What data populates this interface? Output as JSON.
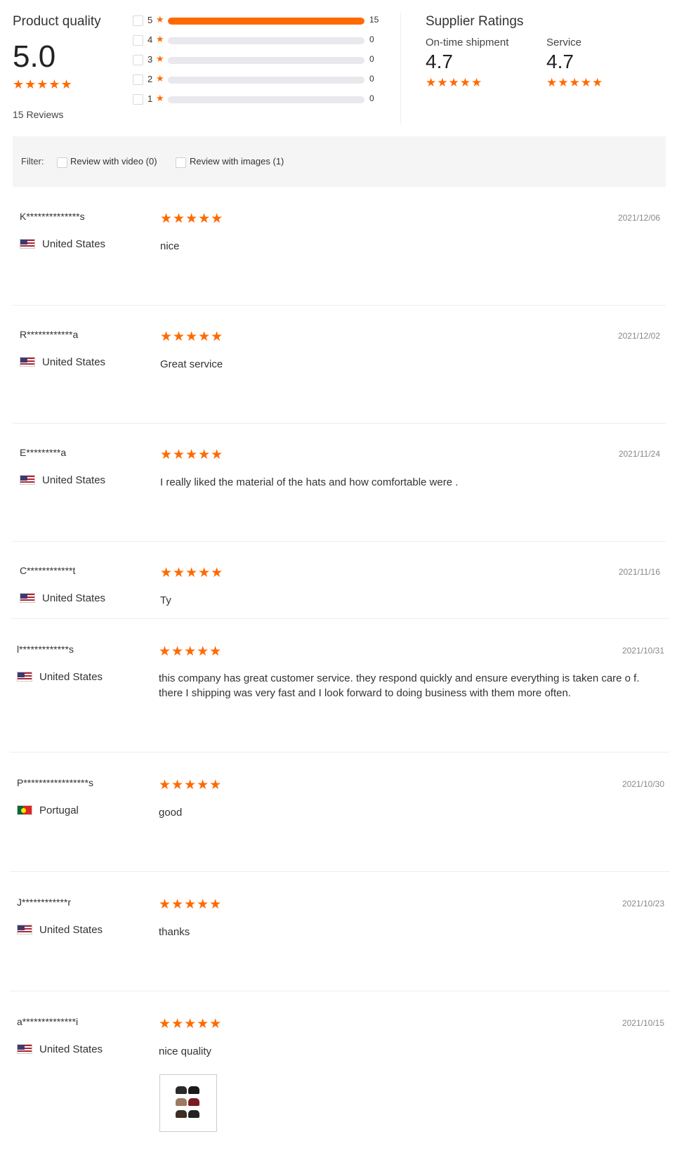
{
  "product_quality": {
    "title": "Product quality",
    "score": "5.0",
    "rating": 5,
    "reviews_label": "15 Reviews",
    "distribution": [
      {
        "stars": "5",
        "count": "15",
        "fraction": 1.0
      },
      {
        "stars": "4",
        "count": "0",
        "fraction": 0
      },
      {
        "stars": "3",
        "count": "0",
        "fraction": 0
      },
      {
        "stars": "2",
        "count": "0",
        "fraction": 0
      },
      {
        "stars": "1",
        "count": "0",
        "fraction": 0
      }
    ]
  },
  "supplier_ratings": {
    "title": "Supplier Ratings",
    "ontime": {
      "label": "On-time shipment",
      "value": "4.7"
    },
    "service": {
      "label": "Service",
      "value": "4.7"
    }
  },
  "filter": {
    "label": "Filter:",
    "video_label": "Review with video (0)",
    "images_label": "Review with images (1)"
  },
  "reviews": [
    {
      "name": "K**************s",
      "country": "United States",
      "flag": "us-flag",
      "date": "2021/12/06",
      "text": "nice",
      "rating": 5
    },
    {
      "name": "R************a",
      "country": "United States",
      "flag": "us-flag",
      "date": "2021/12/02",
      "text": "Great service",
      "rating": 5
    },
    {
      "name": "E*********a",
      "country": "United States",
      "flag": "us-flag",
      "date": "2021/11/24",
      "text": "I really liked the material of the hats and how comfortable were .",
      "rating": 5
    },
    {
      "name": "C************t",
      "country": "United States",
      "flag": "us-flag",
      "date": "2021/11/16",
      "text": "Ty",
      "rating": 5
    },
    {
      "name": "l*************s",
      "country": "United States",
      "flag": "us-flag",
      "date": "2021/10/31",
      "text": "this company has great customer service. they respond quickly and ensure everything is taken care o f. there I shipping was very fast and I look forward to doing business with them more often.",
      "rating": 5
    },
    {
      "name": "P*****************s",
      "country": "Portugal",
      "flag": "portugal-flag",
      "date": "2021/10/30",
      "text": "good",
      "rating": 5
    },
    {
      "name": "J************r",
      "country": "United States",
      "flag": "us-flag",
      "date": "2021/10/23",
      "text": "thanks",
      "rating": 5
    },
    {
      "name": "a**************i",
      "country": "United States",
      "flag": "us-flag",
      "date": "2021/10/15",
      "text": "nice quality",
      "rating": 5
    }
  ],
  "star_char": "★★★★★",
  "accent_color": "#ff6a00"
}
